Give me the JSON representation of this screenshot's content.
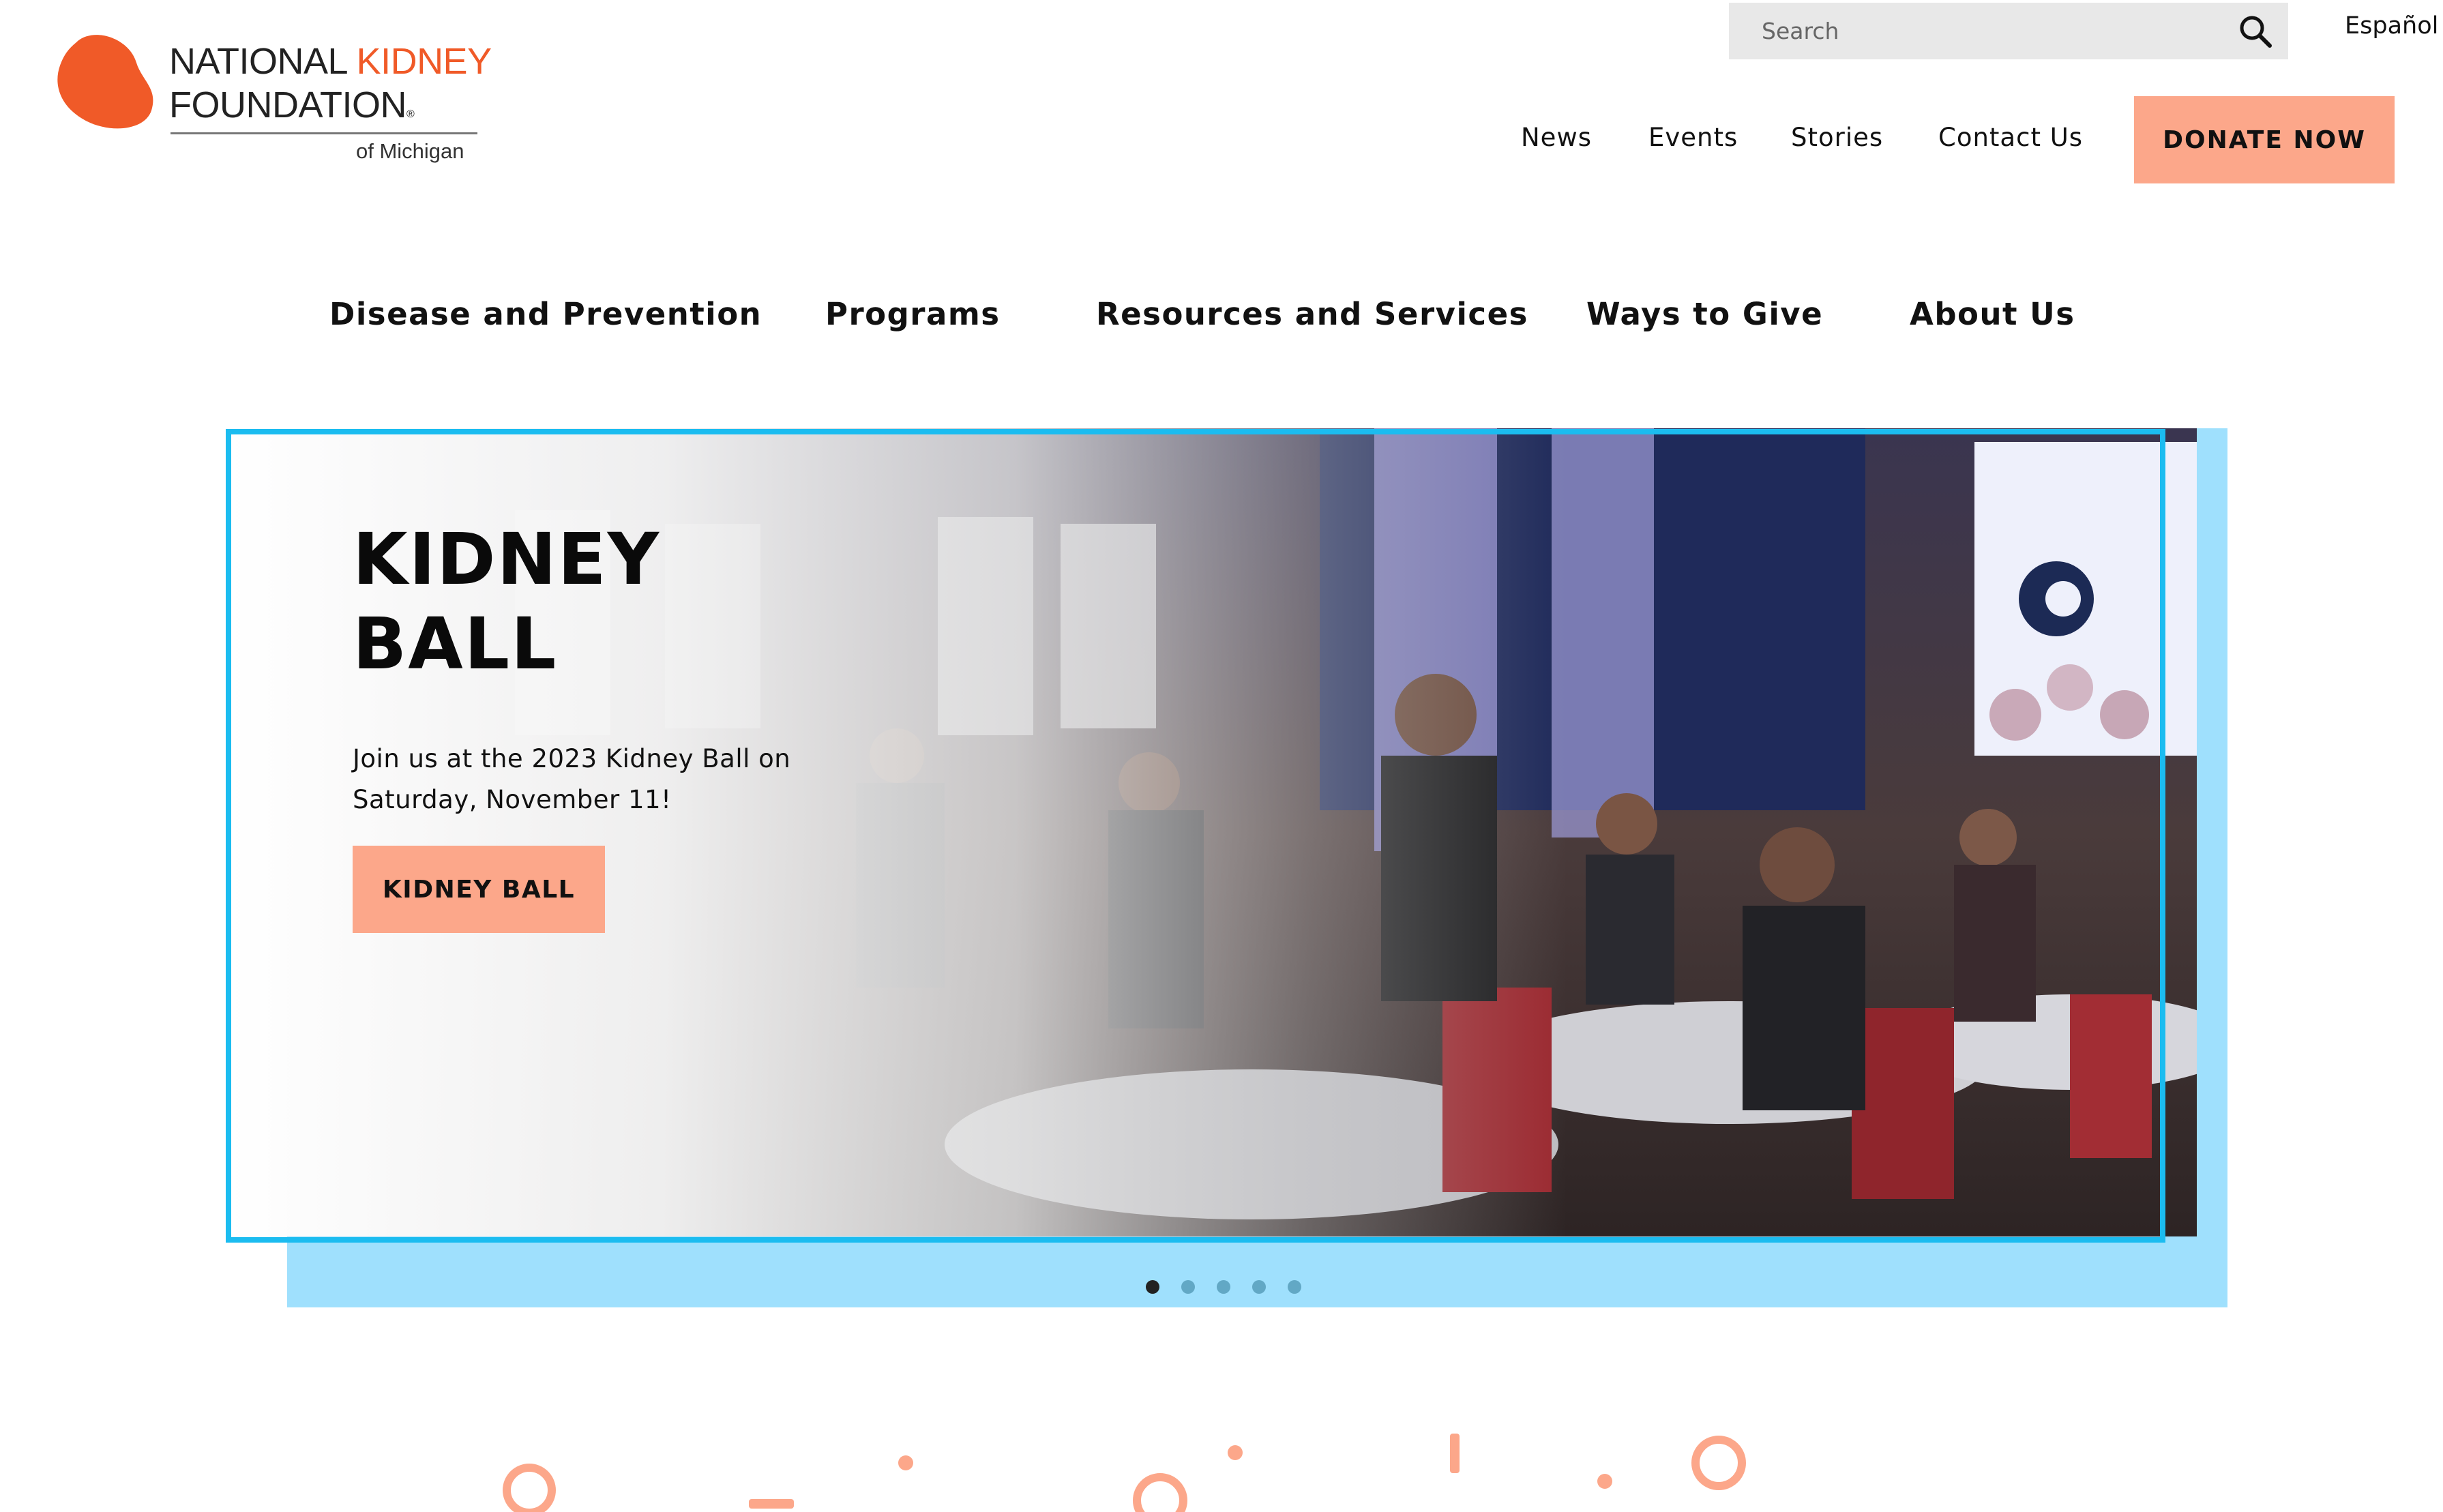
{
  "logo": {
    "line1_a": "NATIONAL ",
    "line1_b": "KIDNEY",
    "line2": "FOUNDATION",
    "registered": "®",
    "sub": "of Michigan"
  },
  "search": {
    "placeholder": "Search"
  },
  "language": "Español",
  "utility_nav": [
    "News",
    "Events",
    "Stories",
    "Contact Us"
  ],
  "donate_label": "DONATE NOW",
  "main_nav": [
    "Disease and Prevention",
    "Programs",
    "Resources and Services",
    "Ways to Give",
    "About Us"
  ],
  "hero": {
    "title": "KIDNEY\nBALL",
    "text": "Join us at the 2023 Kidney Ball on Saturday, November 11!",
    "button": "KIDNEY BALL",
    "slide_count": 5,
    "active_slide": 1
  },
  "colors": {
    "brand_orange": "#f05a28",
    "button_salmon": "#fca78a",
    "frame_blue": "#1bbcf0",
    "backdrop_blue": "#9fe0fd"
  },
  "icons": {
    "search": "search-icon",
    "logo": "kidney-logo-icon"
  }
}
